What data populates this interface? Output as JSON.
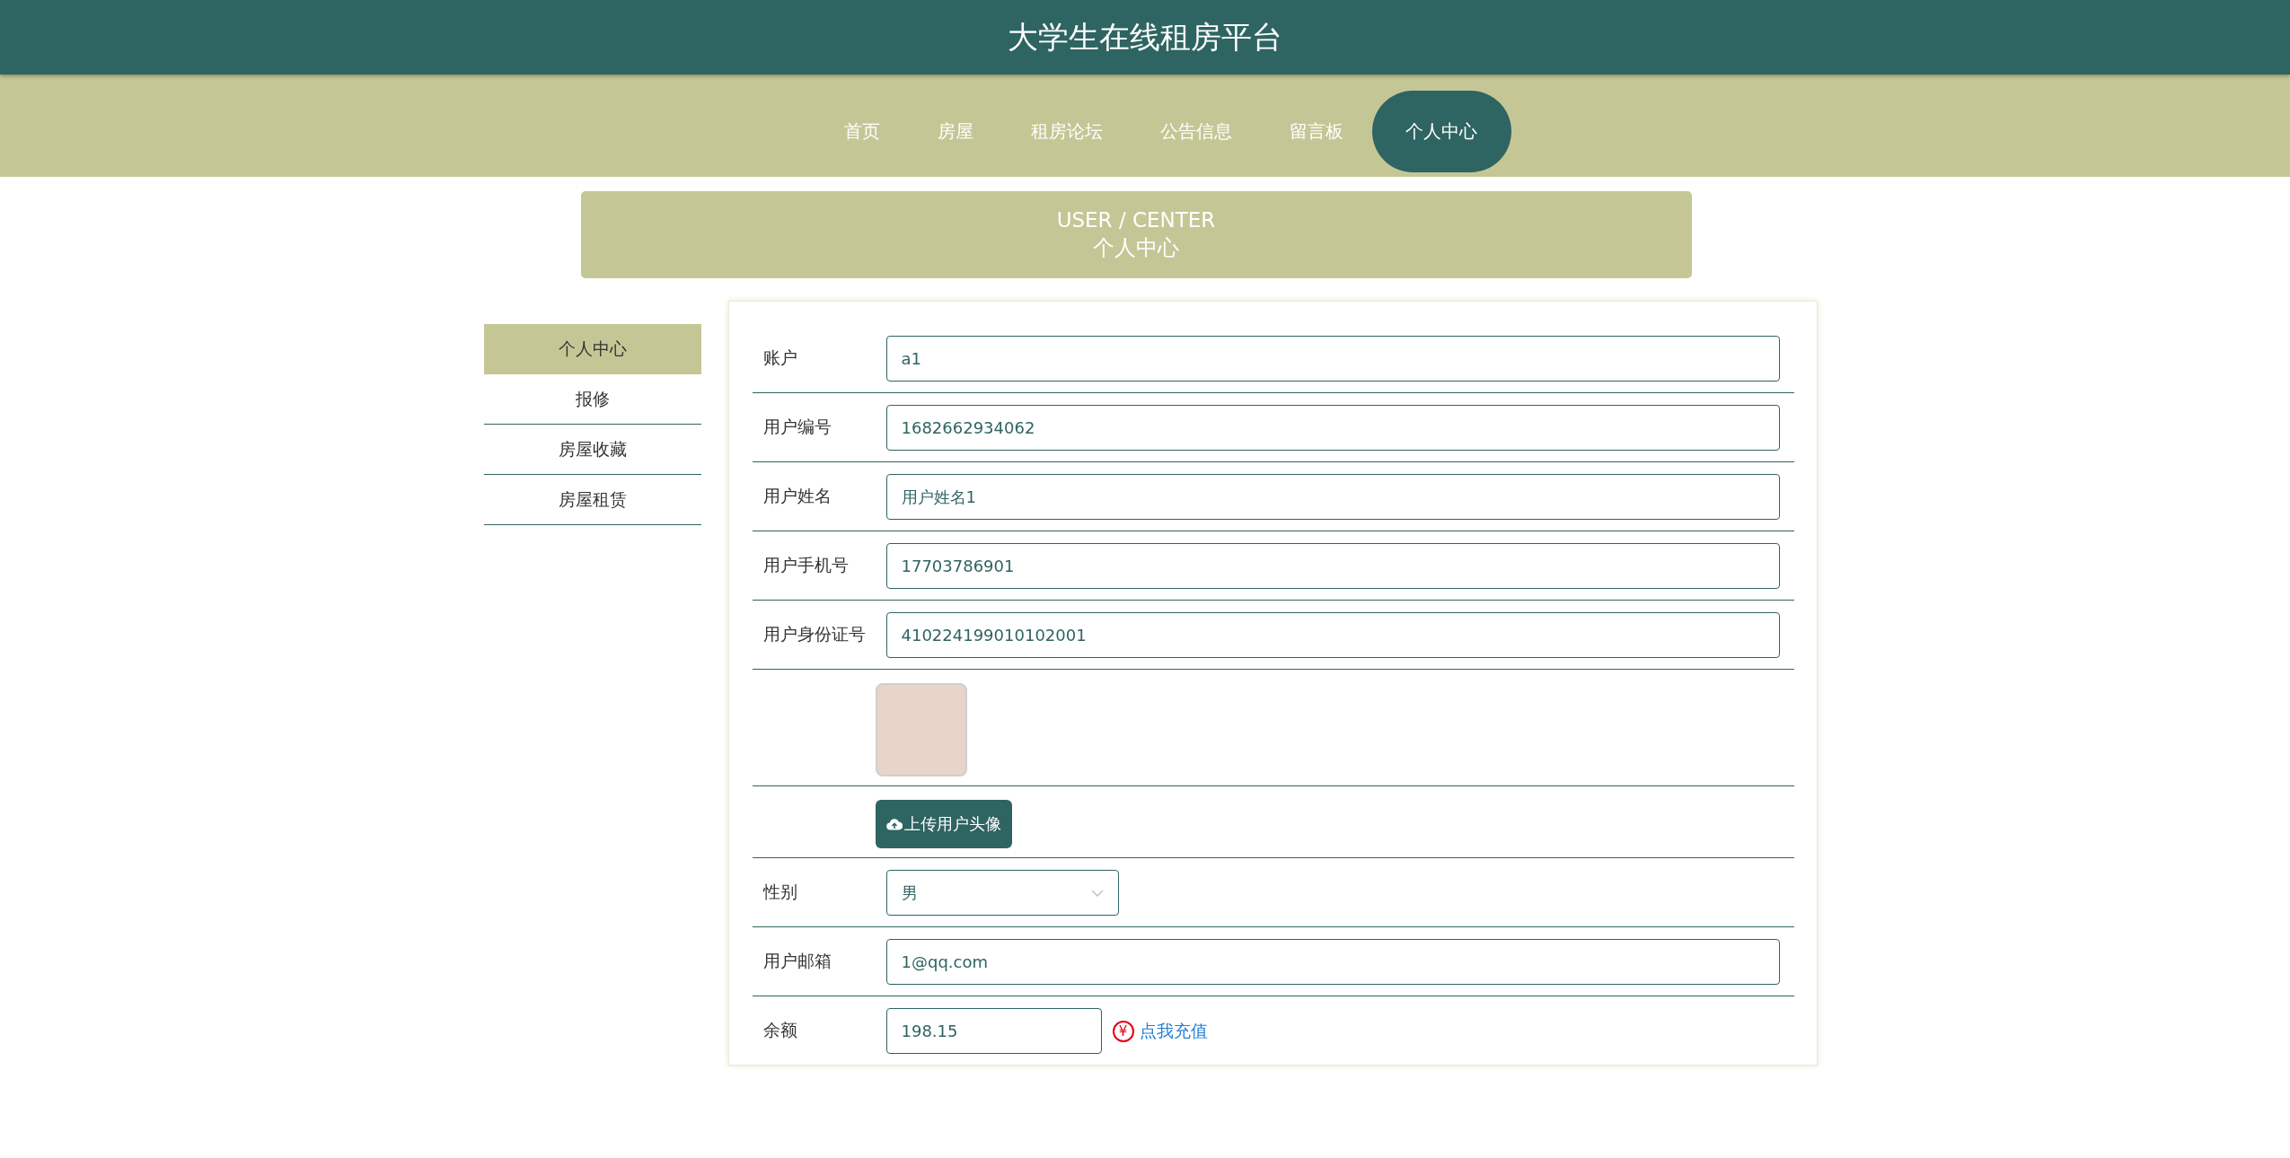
{
  "site_title": "大学生在线租房平台",
  "nav": [
    {
      "label": "首页",
      "selected": false
    },
    {
      "label": "房屋",
      "selected": false
    },
    {
      "label": "租房论坛",
      "selected": false
    },
    {
      "label": "公告信息",
      "selected": false
    },
    {
      "label": "留言板",
      "selected": false
    },
    {
      "label": "个人中心",
      "selected": true
    }
  ],
  "banner": {
    "subtitle": "USER / CENTER",
    "title": "个人中心"
  },
  "sidebar": {
    "items": [
      {
        "label": "个人中心",
        "selected": true
      },
      {
        "label": "报修",
        "selected": false
      },
      {
        "label": "房屋收藏",
        "selected": false
      },
      {
        "label": "房屋租赁",
        "selected": false
      }
    ]
  },
  "form": {
    "rows": [
      {
        "kind": "text",
        "label": "账户",
        "value": "a1"
      },
      {
        "kind": "text",
        "label": "用户编号",
        "value": "1682662934062"
      },
      {
        "kind": "text",
        "label": "用户姓名",
        "value": "用户姓名1"
      },
      {
        "kind": "text",
        "label": "用户手机号",
        "value": "17703786901"
      },
      {
        "kind": "text",
        "label": "用户身份证号",
        "value": "410224199010102001"
      },
      {
        "kind": "avatar"
      },
      {
        "kind": "upload",
        "button": "上传用户头像"
      },
      {
        "kind": "select",
        "label": "性别",
        "value": "男"
      },
      {
        "kind": "text",
        "label": "用户邮箱",
        "value": "1@qq.com"
      },
      {
        "kind": "balance",
        "label": "余额",
        "value": "198.15",
        "icon_text": "¥",
        "link": "点我充值"
      }
    ]
  }
}
